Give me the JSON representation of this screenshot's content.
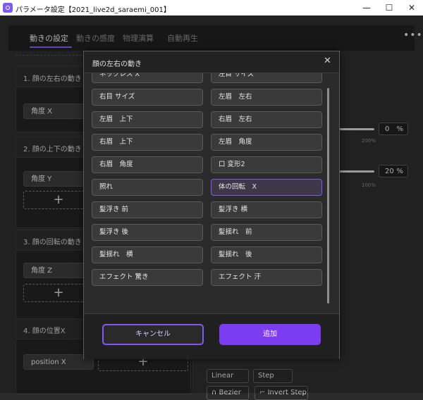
{
  "window": {
    "title": "パラメータ設定【2021_live2d_saraemi_001】",
    "min": "—",
    "max": "☐",
    "close": "✕"
  },
  "tabs": [
    {
      "label": "動きの設定"
    },
    {
      "label": "動きの感度"
    },
    {
      "label": "物理演算"
    },
    {
      "label": "自動再生"
    }
  ],
  "more": "•••",
  "sections": [
    {
      "title": "1. 顔の左右の動き",
      "param": "角度 X"
    },
    {
      "title": "2. 顔の上下の動き",
      "param": "角度 Y"
    },
    {
      "title": "3. 顔の回転の動き",
      "param": "角度 Z"
    },
    {
      "title": "4. 顔の位置X",
      "param": "position X"
    }
  ],
  "add_glyph": "+",
  "right": {
    "v1": "0",
    "u1": "%",
    "p1": "200%",
    "v2": "20",
    "u2": "%",
    "p2": "100%",
    "linear": "Linear",
    "step": "Step",
    "bezier": "Bezier",
    "invert_step": "Invert Step"
  },
  "modal": {
    "title": "顔の左右の動き",
    "close": "✕",
    "items": [
      "ネックレス X",
      "左目 サイズ",
      "右目 サイズ",
      "左眉　左右",
      "左眉　上下",
      "右眉　左右",
      "右眉　上下",
      "左眉　角度",
      "右眉　角度",
      "口 変形2",
      "照れ",
      "体の回転　X",
      "髪浮き 前",
      "髪浮き 横",
      "髪浮き 後",
      "髪揺れ　前",
      "髪揺れ　横",
      "髪揺れ　後",
      "エフェクト 驚き",
      "エフェクト 汗"
    ],
    "selected_index": 11,
    "cancel": "キャンセル",
    "add": "追加"
  }
}
